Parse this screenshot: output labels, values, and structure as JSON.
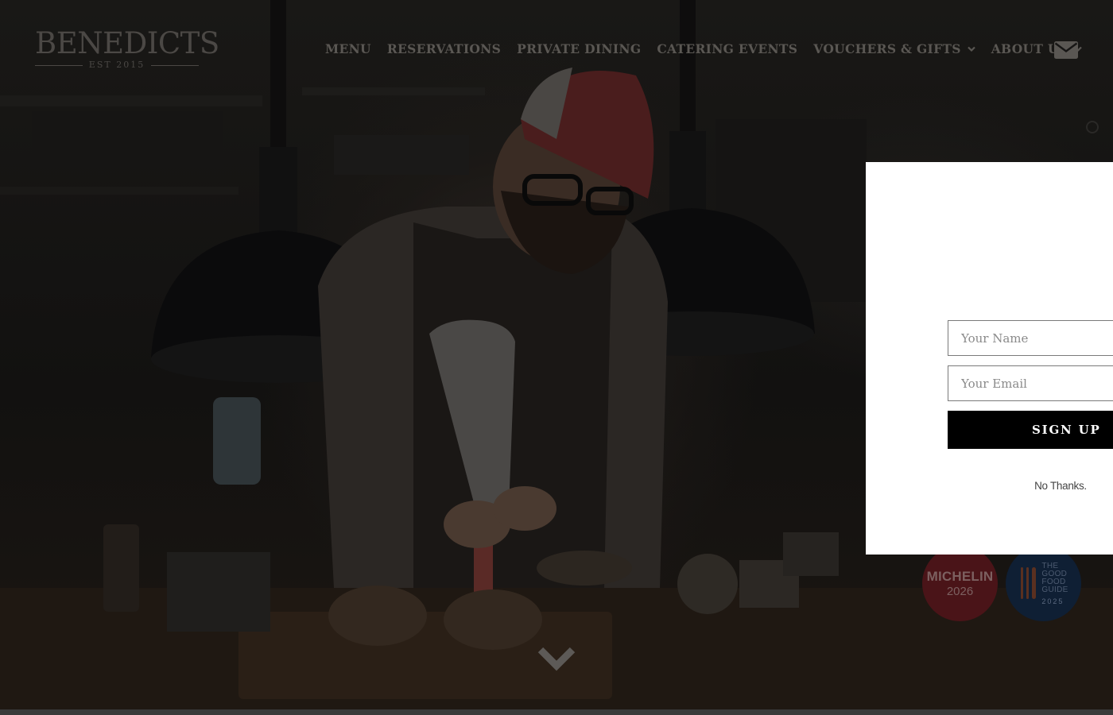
{
  "brand": {
    "name": "BENEDICTS",
    "tagline": "EST 2015"
  },
  "nav": {
    "items": [
      {
        "label": "MENU"
      },
      {
        "label": "RESERVATIONS"
      },
      {
        "label": "PRIVATE DINING"
      },
      {
        "label": "CATERING EVENTS"
      },
      {
        "label": "VOUCHERS & GIFTS"
      },
      {
        "label": "ABOUT US"
      }
    ],
    "mail_icon": "envelope-icon"
  },
  "badges": {
    "michelin": {
      "name": "MICHELIN",
      "year": "2026"
    },
    "good_food_guide": {
      "line1": "THE",
      "line2": "GOOD",
      "line3": "FOOD",
      "line4": "GUIDE",
      "year": "2025"
    }
  },
  "popup": {
    "name_placeholder": "Your Name",
    "email_placeholder": "Your Email",
    "signup_label": "SIGN UP",
    "dismiss_label": "No Thanks."
  },
  "colors": {
    "overlay_text": "#5a5753",
    "popup_bg": "#ffffff",
    "button_bg": "#000000",
    "michelin_red": "#4a1418",
    "gfg_navy": "#0f1f34"
  }
}
